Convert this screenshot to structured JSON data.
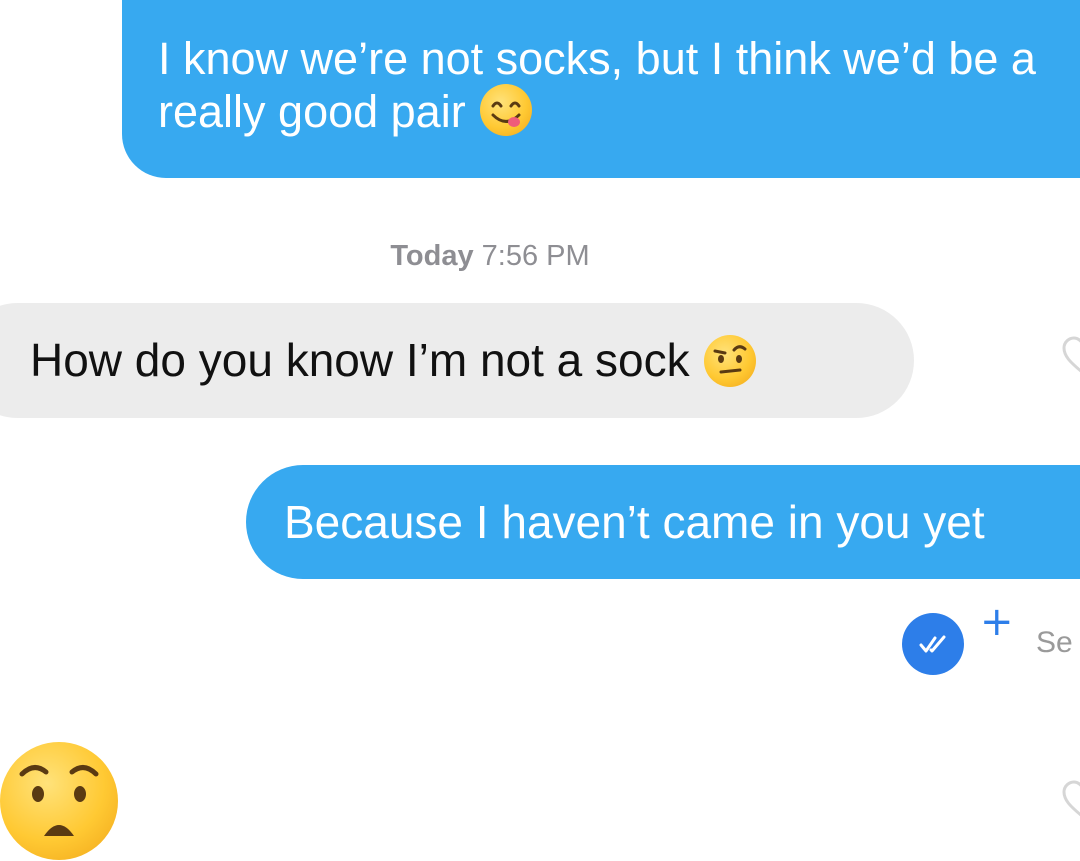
{
  "conversation": {
    "messages": [
      {
        "sender": "me",
        "text": "I know we’re not socks, but I think we’d be a really good pair",
        "emoji": "face-savoring-food-emoji"
      },
      {
        "sender": "them",
        "text": "How do you know I’m not a sock",
        "emoji": "face-with-raised-eyebrow-emoji"
      },
      {
        "sender": "me",
        "text": "Because I haven’t came in you yet"
      }
    ],
    "timestamp": {
      "day": "Today",
      "time": "7:56 PM"
    },
    "status": {
      "plus": "+",
      "seen_label": "Se"
    },
    "reaction_emoji": "anxious-face-emoji"
  },
  "colors": {
    "outgoing_bubble": "#37a9f0",
    "incoming_bubble": "#ececec",
    "seen_badge": "#2d7ee9",
    "timestamp_text": "#8e8e93"
  },
  "icons": [
    "react-heart-icon",
    "double-check-icon"
  ]
}
